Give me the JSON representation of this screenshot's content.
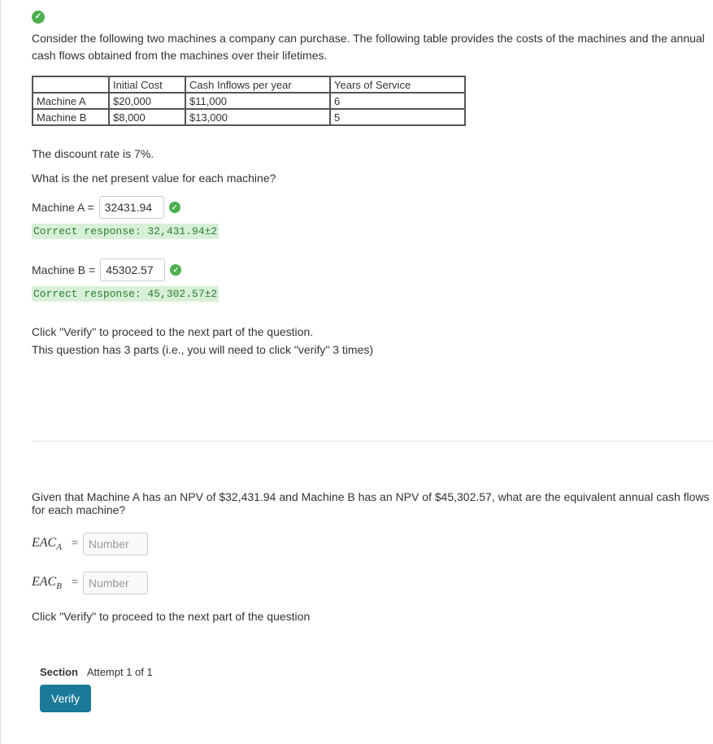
{
  "part1": {
    "intro": "Consider the following two machines a company can purchase. The following table provides the costs of the machines and the annual cash flows obtained from the machines over their lifetimes.",
    "table": {
      "headers": {
        "c0": "",
        "c1": "Initial Cost",
        "c2": "Cash Inflows per year",
        "c3": "Years of Service"
      },
      "rows": [
        {
          "name": "Machine A",
          "cost": "$20,000",
          "inflow": "$11,000",
          "years": "6"
        },
        {
          "name": "Machine B",
          "cost": "$8,000",
          "inflow": "$13,000",
          "years": "5"
        }
      ]
    },
    "discount": "The discount rate is 7%.",
    "question": "What is the net present value for each machine?",
    "answers": {
      "a": {
        "label": "Machine A =",
        "value": "32431.94",
        "correct": "Correct response: 32,431.94±2"
      },
      "b": {
        "label": "Machine B =",
        "value": "45302.57",
        "correct": "Correct response: 45,302.57±2"
      }
    },
    "instr1": "Click \"Verify\" to proceed to the next part of the question.",
    "instr2": "This question has 3 parts (i.e., you will need to click \"verify\" 3 times)"
  },
  "part2": {
    "question": "Given that Machine A has an NPV of $32,431.94 and Machine B has an NPV of $45,302.57, what are the equivalent annual cash flows for each machine?",
    "eac_a_label": "EAC",
    "eac_a_sub": "A",
    "eac_b_label": "EAC",
    "eac_b_sub": "B",
    "placeholder": "Number",
    "instr": "Click \"Verify\" to proceed to the next part of the question"
  },
  "footer": {
    "section_label": "Section",
    "attempt": "Attempt 1 of 1",
    "verify": "Verify"
  }
}
